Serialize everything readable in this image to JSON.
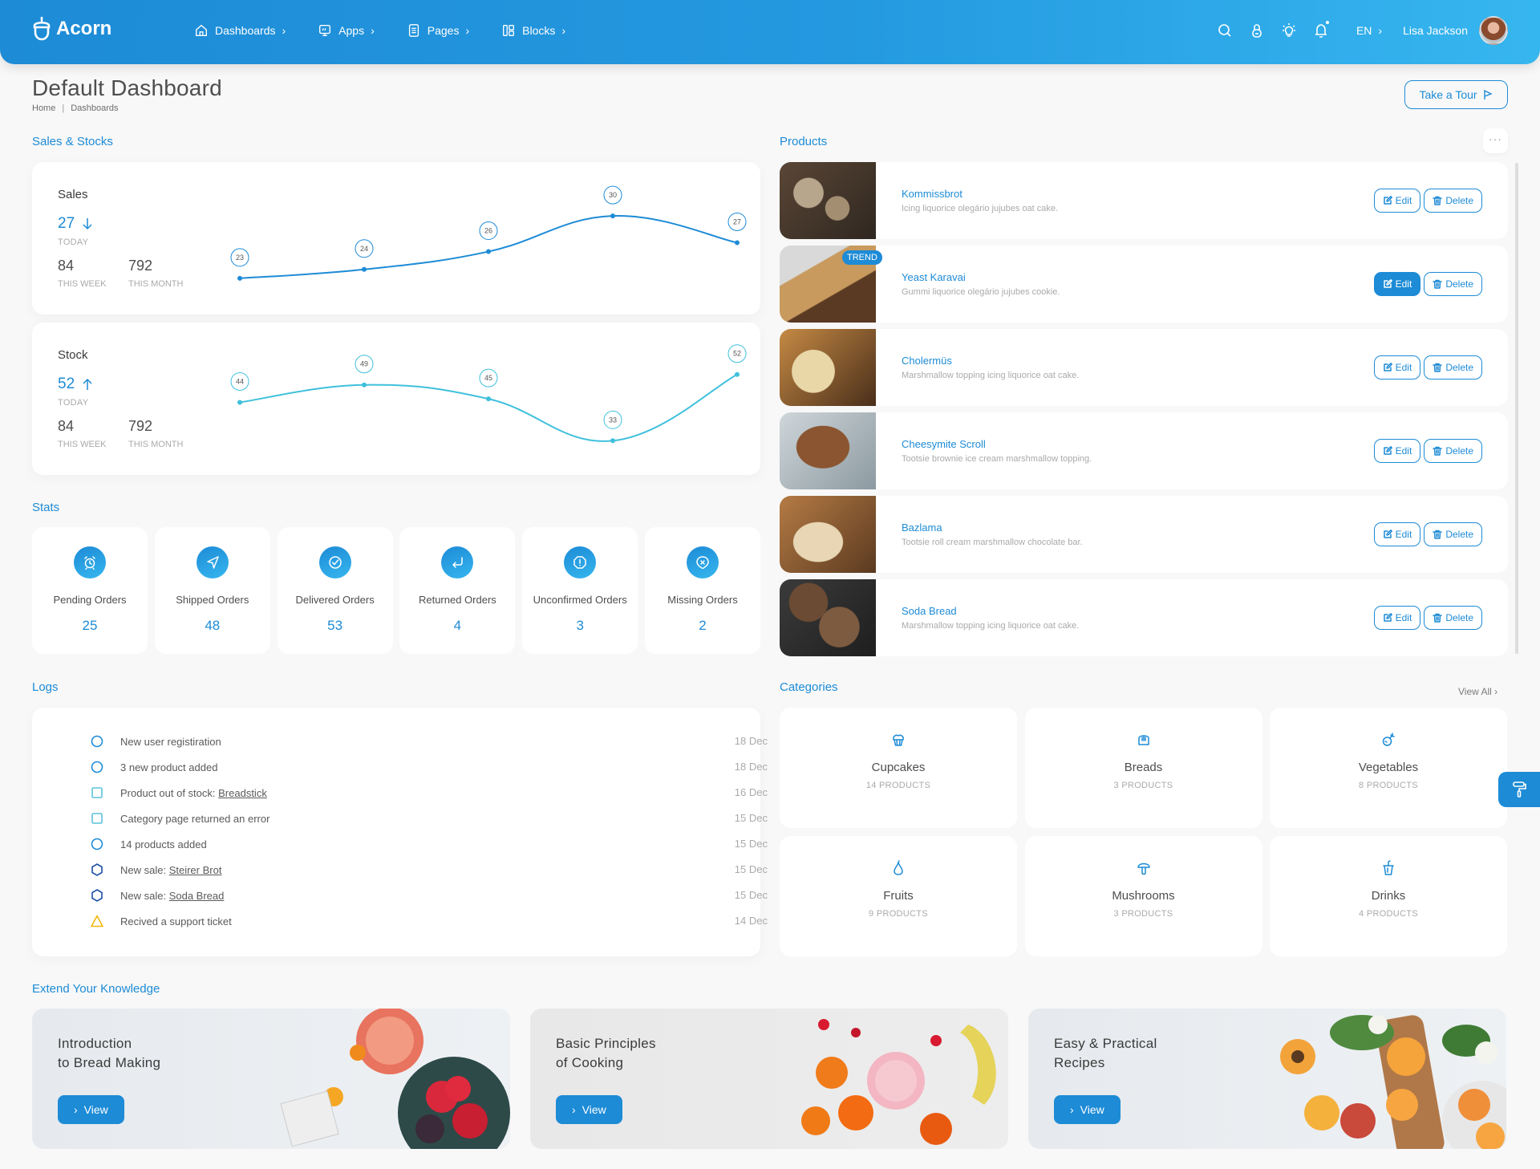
{
  "header": {
    "brand": "Acorn",
    "nav": [
      {
        "label": "Dashboards",
        "icon": "home-icon"
      },
      {
        "label": "Apps",
        "icon": "screen-icon"
      },
      {
        "label": "Pages",
        "icon": "file-icon"
      },
      {
        "label": "Blocks",
        "icon": "grid-icon"
      }
    ],
    "language": "EN",
    "user_name": "Lisa Jackson"
  },
  "page": {
    "title": "Default Dashboard",
    "breadcrumb": [
      "Home",
      "Dashboards"
    ],
    "tour_button": "Take a Tour"
  },
  "sections": {
    "sales_stocks": "Sales & Stocks",
    "products": "Products",
    "stats": "Stats",
    "logs": "Logs",
    "categories": "Categories",
    "categories_view_all": "View All",
    "knowledge": "Extend Your Knowledge"
  },
  "charts": {
    "sales": {
      "label": "Sales",
      "today": "27",
      "today_trend": "down",
      "today_label": "TODAY",
      "week": "84",
      "week_label": "THIS WEEK",
      "month": "792",
      "month_label": "THIS MONTH",
      "color": "#1d8bd6"
    },
    "stock": {
      "label": "Stock",
      "today": "52",
      "today_trend": "up",
      "today_label": "TODAY",
      "week": "84",
      "week_label": "THIS WEEK",
      "month": "792",
      "month_label": "THIS MONTH",
      "color": "#3fc0dc"
    }
  },
  "chart_data": [
    {
      "type": "line",
      "title": "Sales",
      "x": [
        1,
        2,
        3,
        4,
        5
      ],
      "values": [
        23,
        24,
        26,
        30,
        27
      ],
      "data_labels": true,
      "smooth": true,
      "grid": false,
      "ylim": [
        22,
        31
      ]
    },
    {
      "type": "line",
      "title": "Stock",
      "x": [
        1,
        2,
        3,
        4,
        5
      ],
      "values": [
        44,
        49,
        45,
        33,
        52
      ],
      "data_labels": true,
      "smooth": true,
      "grid": false,
      "ylim": [
        31,
        54
      ]
    }
  ],
  "stats": [
    {
      "title": "Pending Orders",
      "value": "25",
      "icon": "alarm-clock-icon"
    },
    {
      "title": "Shipped Orders",
      "value": "48",
      "icon": "navigation-icon"
    },
    {
      "title": "Delivered Orders",
      "value": "53",
      "icon": "check-circle-icon"
    },
    {
      "title": "Returned Orders",
      "value": "4",
      "icon": "return-arrow-icon"
    },
    {
      "title": "Unconfirmed Orders",
      "value": "3",
      "icon": "warning-octagon-icon"
    },
    {
      "title": "Missing Orders",
      "value": "2",
      "icon": "x-shield-icon"
    }
  ],
  "products": [
    {
      "name": "Kommissbrot",
      "desc": "Icing liquorice olegário jujubes oat cake.",
      "badge": null,
      "edit_active": false
    },
    {
      "name": "Yeast Karavai",
      "desc": "Gummi liquorice olegário jujubes cookie.",
      "badge": "TREND",
      "edit_active": true
    },
    {
      "name": "Cholermüs",
      "desc": "Marshmallow topping icing liquorice oat cake.",
      "badge": null,
      "edit_active": false
    },
    {
      "name": "Cheesymite Scroll",
      "desc": "Tootsie brownie ice cream marshmallow topping.",
      "badge": null,
      "edit_active": false
    },
    {
      "name": "Bazlama",
      "desc": "Tootsie roll cream marshmallow chocolate bar.",
      "badge": null,
      "edit_active": false
    },
    {
      "name": "Soda Bread",
      "desc": "Marshmallow topping icing liquorice oat cake.",
      "badge": null,
      "edit_active": false
    }
  ],
  "product_actions": {
    "edit": "Edit",
    "delete": "Delete"
  },
  "logs": [
    {
      "text": "New user registiration",
      "link": "",
      "date": "18 Dec",
      "icon": "circle",
      "color": "#1d8bd6"
    },
    {
      "text": "3 new product added",
      "link": "",
      "date": "18 Dec",
      "icon": "circle",
      "color": "#1d8bd6"
    },
    {
      "text": "Product out of stock: ",
      "link": "Breadstick",
      "date": "16 Dec",
      "icon": "square",
      "color": "#5bc2dc"
    },
    {
      "text": "Category page returned an error",
      "link": "",
      "date": "15 Dec",
      "icon": "square",
      "color": "#5bc2dc"
    },
    {
      "text": "14 products added",
      "link": "",
      "date": "15 Dec",
      "icon": "circle",
      "color": "#1d8bd6"
    },
    {
      "text": "New sale: ",
      "link": "Steirer Brot",
      "date": "15 Dec",
      "icon": "hexagon",
      "color": "#1e4fa6"
    },
    {
      "text": "New sale: ",
      "link": "Soda Bread",
      "date": "15 Dec",
      "icon": "hexagon",
      "color": "#1e4fa6"
    },
    {
      "text": "Recived a support ticket",
      "link": "",
      "date": "14 Dec",
      "icon": "triangle",
      "color": "#f2b70d"
    }
  ],
  "categories": [
    {
      "name": "Cupcakes",
      "count": "14 PRODUCTS",
      "icon": "cupcake-icon"
    },
    {
      "name": "Breads",
      "count": "3 PRODUCTS",
      "icon": "bread-icon"
    },
    {
      "name": "Vegetables",
      "count": "8 PRODUCTS",
      "icon": "radish-icon"
    },
    {
      "name": "Fruits",
      "count": "9 PRODUCTS",
      "icon": "pear-icon"
    },
    {
      "name": "Mushrooms",
      "count": "3 PRODUCTS",
      "icon": "mushroom-icon"
    },
    {
      "name": "Drinks",
      "count": "4 PRODUCTS",
      "icon": "cup-straw-icon"
    }
  ],
  "knowledge": [
    {
      "title": "Introduction\nto Bread Making",
      "button": "View"
    },
    {
      "title": "Basic Principles\nof Cooking",
      "button": "View"
    },
    {
      "title": "Easy & Practical\nRecipes",
      "button": "View"
    }
  ],
  "colors": {
    "primary": "#1d8bd6",
    "secondary": "#3fc0dc",
    "background": "#f8f8f8"
  }
}
